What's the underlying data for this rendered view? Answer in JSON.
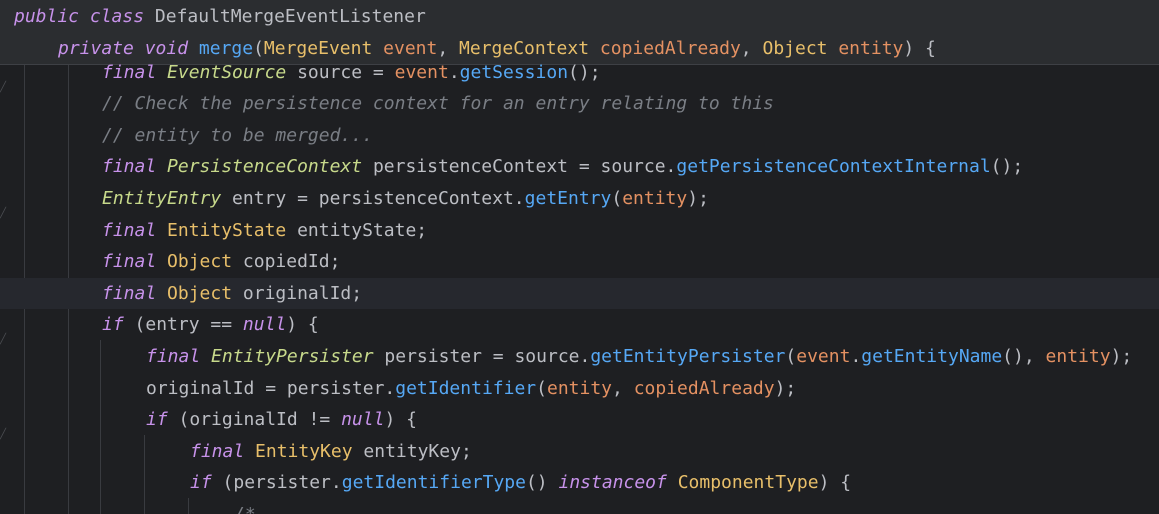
{
  "editor": {
    "sticky_lines": [
      {
        "tokens": [
          {
            "t": "public ",
            "c": "pu"
          },
          {
            "t": "class ",
            "c": "pu"
          },
          {
            "t": "DefaultMergeEventListener",
            "c": "plain"
          }
        ]
      },
      {
        "tokens": [
          {
            "t": "private ",
            "c": "pu"
          },
          {
            "t": "void ",
            "c": "pu"
          },
          {
            "t": "merge",
            "c": "fn"
          },
          {
            "t": "(",
            "c": "plain"
          },
          {
            "t": "MergeEvent ",
            "c": "cls"
          },
          {
            "t": "event",
            "c": "par"
          },
          {
            "t": ", ",
            "c": "plain"
          },
          {
            "t": "MergeContext ",
            "c": "cls"
          },
          {
            "t": "copiedAlready",
            "c": "par"
          },
          {
            "t": ", ",
            "c": "plain"
          },
          {
            "t": "Object ",
            "c": "cls"
          },
          {
            "t": "entity",
            "c": "par"
          },
          {
            "t": ") {",
            "c": "plain"
          }
        ]
      }
    ],
    "lines": [
      {
        "indent": 2,
        "tokens": [
          {
            "t": "final ",
            "c": "pu"
          },
          {
            "t": "EventSource ",
            "c": "tyi"
          },
          {
            "t": "source = ",
            "c": "plain"
          },
          {
            "t": "event",
            "c": "par"
          },
          {
            "t": ".",
            "c": "plain"
          },
          {
            "t": "getSession",
            "c": "fn"
          },
          {
            "t": "();",
            "c": "plain"
          }
        ]
      },
      {
        "indent": 2,
        "tokens": [
          {
            "t": "// Check the persistence context for an entry relating to this",
            "c": "cm"
          }
        ]
      },
      {
        "indent": 2,
        "tokens": [
          {
            "t": "// entity to be merged...",
            "c": "cm"
          }
        ]
      },
      {
        "indent": 2,
        "tokens": [
          {
            "t": "final ",
            "c": "pu"
          },
          {
            "t": "PersistenceContext ",
            "c": "tyi"
          },
          {
            "t": "persistenceContext = ",
            "c": "plain"
          },
          {
            "t": "source",
            "c": "plain"
          },
          {
            "t": ".",
            "c": "plain"
          },
          {
            "t": "getPersistenceContextInternal",
            "c": "fn"
          },
          {
            "t": "();",
            "c": "plain"
          }
        ]
      },
      {
        "indent": 2,
        "tokens": [
          {
            "t": "EntityEntry ",
            "c": "tyi"
          },
          {
            "t": "entry = persistenceContext.",
            "c": "plain"
          },
          {
            "t": "getEntry",
            "c": "fn"
          },
          {
            "t": "(",
            "c": "plain"
          },
          {
            "t": "entity",
            "c": "par"
          },
          {
            "t": ");",
            "c": "plain"
          }
        ]
      },
      {
        "indent": 2,
        "tokens": [
          {
            "t": "final ",
            "c": "pu"
          },
          {
            "t": "EntityState ",
            "c": "cls"
          },
          {
            "t": "entityState;",
            "c": "plain"
          }
        ]
      },
      {
        "indent": 2,
        "tokens": [
          {
            "t": "final ",
            "c": "pu"
          },
          {
            "t": "Object ",
            "c": "cls"
          },
          {
            "t": "copiedId;",
            "c": "plain"
          }
        ]
      },
      {
        "indent": 2,
        "caret": true,
        "tokens": [
          {
            "t": "final ",
            "c": "pu"
          },
          {
            "t": "Object ",
            "c": "cls"
          },
          {
            "t": "originalId;",
            "c": "plain"
          }
        ]
      },
      {
        "indent": 2,
        "tokens": [
          {
            "t": "if ",
            "c": "pu"
          },
          {
            "t": "(entry == ",
            "c": "plain"
          },
          {
            "t": "null",
            "c": "pu"
          },
          {
            "t": ") {",
            "c": "plain"
          }
        ]
      },
      {
        "indent": 3,
        "tokens": [
          {
            "t": "final ",
            "c": "pu"
          },
          {
            "t": "EntityPersister ",
            "c": "tyi"
          },
          {
            "t": "persister = source.",
            "c": "plain"
          },
          {
            "t": "getEntityPersister",
            "c": "fn"
          },
          {
            "t": "(",
            "c": "plain"
          },
          {
            "t": "event",
            "c": "par"
          },
          {
            "t": ".",
            "c": "plain"
          },
          {
            "t": "getEntityName",
            "c": "fn"
          },
          {
            "t": "(), ",
            "c": "plain"
          },
          {
            "t": "entity",
            "c": "par"
          },
          {
            "t": ");",
            "c": "plain"
          }
        ]
      },
      {
        "indent": 3,
        "tokens": [
          {
            "t": "originalId = persister.",
            "c": "plain"
          },
          {
            "t": "getIdentifier",
            "c": "fn"
          },
          {
            "t": "(",
            "c": "plain"
          },
          {
            "t": "entity",
            "c": "par"
          },
          {
            "t": ", ",
            "c": "plain"
          },
          {
            "t": "copiedAlready",
            "c": "par"
          },
          {
            "t": ");",
            "c": "plain"
          }
        ]
      },
      {
        "indent": 3,
        "tokens": [
          {
            "t": "if ",
            "c": "pu"
          },
          {
            "t": "(originalId != ",
            "c": "plain"
          },
          {
            "t": "null",
            "c": "pu"
          },
          {
            "t": ") {",
            "c": "plain"
          }
        ]
      },
      {
        "indent": 4,
        "tokens": [
          {
            "t": "final ",
            "c": "pu"
          },
          {
            "t": "EntityKey ",
            "c": "cls"
          },
          {
            "t": "entityKey;",
            "c": "plain"
          }
        ]
      },
      {
        "indent": 4,
        "tokens": [
          {
            "t": "if ",
            "c": "pu"
          },
          {
            "t": "(persister.",
            "c": "plain"
          },
          {
            "t": "getIdentifierType",
            "c": "fn"
          },
          {
            "t": "() ",
            "c": "plain"
          },
          {
            "t": "instanceof ",
            "c": "pu"
          },
          {
            "t": "ComponentType",
            "c": "cls"
          },
          {
            "t": ") {",
            "c": "plain"
          }
        ]
      },
      {
        "indent": 5,
        "tokens": [
          {
            "t": "/*",
            "c": "cm"
          }
        ]
      }
    ],
    "colors": {
      "background": "#1e1f22",
      "sticky_background": "#2b2d30",
      "caret_row": "#26282e",
      "keyword": "#c792ea",
      "type": "#e8bf6a",
      "function": "#56a8f5",
      "parameter": "#e49162",
      "comment": "#7a7e85",
      "plain": "#bcbec4"
    }
  }
}
